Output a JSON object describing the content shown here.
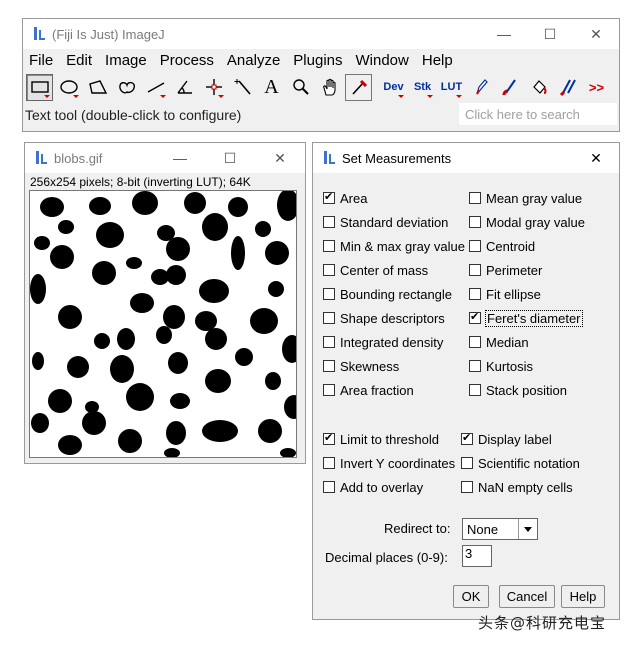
{
  "main_window": {
    "title": "(Fiji Is Just) ImageJ",
    "menus": [
      "File",
      "Edit",
      "Image",
      "Process",
      "Analyze",
      "Plugins",
      "Window",
      "Help"
    ],
    "tools": [
      {
        "name": "rectangle-tool",
        "kind": "icon"
      },
      {
        "name": "oval-tool",
        "kind": "icon"
      },
      {
        "name": "polygon-tool",
        "kind": "icon"
      },
      {
        "name": "freehand-tool",
        "kind": "icon"
      },
      {
        "name": "line-tool",
        "kind": "icon"
      },
      {
        "name": "angle-tool",
        "kind": "icon"
      },
      {
        "name": "point-tool",
        "kind": "icon"
      },
      {
        "name": "wand-tool",
        "kind": "icon"
      },
      {
        "name": "text-tool",
        "kind": "icon"
      },
      {
        "name": "magnifying-glass-tool",
        "kind": "icon"
      },
      {
        "name": "scrolling-tool",
        "kind": "icon"
      },
      {
        "name": "color-picker-tool",
        "kind": "icon"
      },
      {
        "name": "dev-tool",
        "label": "Dev"
      },
      {
        "name": "stk-tool",
        "label": "Stk"
      },
      {
        "name": "lut-tool",
        "label": "LUT"
      },
      {
        "name": "pencil-tool",
        "kind": "icon"
      },
      {
        "name": "brush-tool",
        "kind": "icon"
      },
      {
        "name": "flood-fill-tool",
        "kind": "icon"
      },
      {
        "name": "multi-brush-tool",
        "kind": "icon"
      },
      {
        "name": "more-tools",
        "label": ">>"
      }
    ],
    "status": "Text tool (double-click to configure)",
    "search_placeholder": "Click here to search"
  },
  "image_window": {
    "title": "blobs.gif",
    "info": "256x254 pixels; 8-bit (inverting LUT); 64K"
  },
  "dialog": {
    "title": "Set Measurements",
    "left_options": [
      {
        "label": "Area",
        "checked": true
      },
      {
        "label": "Standard deviation",
        "checked": false
      },
      {
        "label": "Min & max gray value",
        "checked": false
      },
      {
        "label": "Center of mass",
        "checked": false
      },
      {
        "label": "Bounding rectangle",
        "checked": false
      },
      {
        "label": "Shape descriptors",
        "checked": false
      },
      {
        "label": "Integrated density",
        "checked": false
      },
      {
        "label": "Skewness",
        "checked": false
      },
      {
        "label": "Area fraction",
        "checked": false
      }
    ],
    "right_options": [
      {
        "label": "Mean gray value",
        "checked": false
      },
      {
        "label": "Modal gray value",
        "checked": false
      },
      {
        "label": "Centroid",
        "checked": false
      },
      {
        "label": "Perimeter",
        "checked": false
      },
      {
        "label": "Fit ellipse",
        "checked": false
      },
      {
        "label": "Feret's diameter",
        "checked": true
      },
      {
        "label": "Median",
        "checked": false
      },
      {
        "label": "Kurtosis",
        "checked": false
      },
      {
        "label": "Stack position",
        "checked": false
      }
    ],
    "extra_left": [
      {
        "label": "Limit to threshold",
        "checked": true
      },
      {
        "label": "Invert Y coordinates",
        "checked": false
      },
      {
        "label": "Add to overlay",
        "checked": false
      }
    ],
    "extra_right": [
      {
        "label": "Display label",
        "checked": true
      },
      {
        "label": "Scientific notation",
        "checked": false
      },
      {
        "label": "NaN empty cells",
        "checked": false
      }
    ],
    "redirect_label": "Redirect to:",
    "redirect_value": "None",
    "decimal_label": "Decimal places (0-9):",
    "decimal_value": "3",
    "ok_label": "OK",
    "cancel_label": "Cancel",
    "help_label": "Help"
  },
  "watermark": "头条@科研充电宝"
}
